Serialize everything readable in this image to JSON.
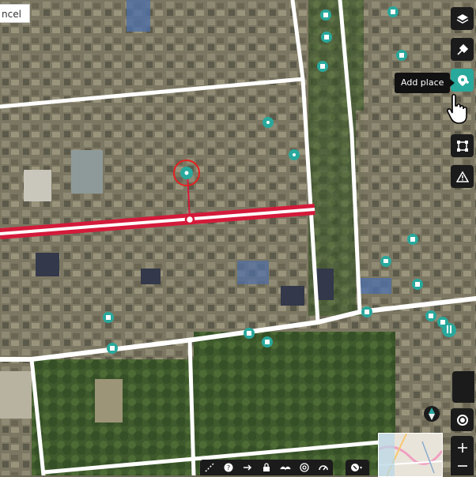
{
  "cancel_label": "ncel",
  "tooltip": "Add place",
  "colors": {
    "accent": "#29a89c",
    "selected_road": "#d41a3a",
    "road": "#ffffff",
    "toolbar_bg": "#1b1b1b"
  },
  "toolbar": [
    "layers-icon",
    "satellite-icon",
    "add-place-icon",
    "area-icon",
    "issues-icon"
  ],
  "map_controls": [
    "compass-icon",
    "geolocate-icon",
    "zoom-in-icon",
    "zoom-out-icon"
  ],
  "bottom_tools": [
    "measure-icon",
    "help-icon",
    "next-icon",
    "lock-icon",
    "history-icon",
    "location-icon",
    "gauge-icon",
    "walkthrough-icon"
  ]
}
